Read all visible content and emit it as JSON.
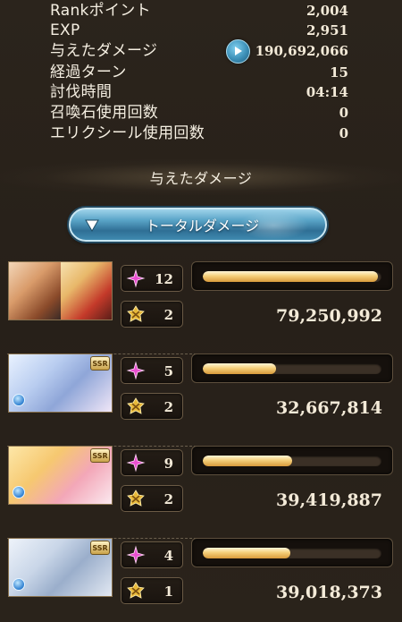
{
  "stats": [
    {
      "label": "Rankポイント",
      "value": "2,004"
    },
    {
      "label": "EXP",
      "value": "2,951"
    },
    {
      "label": "与えたダメージ",
      "value": "190,692,066",
      "has_play_button": true
    },
    {
      "label": "経過ターン",
      "value": "15"
    },
    {
      "label": "討伐時間",
      "value": "04:14"
    },
    {
      "label": "召喚石使用回数",
      "value": "0"
    },
    {
      "label": "エリクシール使用回数",
      "value": "0"
    }
  ],
  "section_header": "与えたダメージ",
  "dropdown": {
    "label": "トータルダメージ"
  },
  "characters": [
    {
      "portrait": "dual-character-portrait",
      "count_a": "12",
      "count_b": "2",
      "bar_fraction": 0.98,
      "damage": "79,250,992"
    },
    {
      "portrait": "ssr-character-portrait",
      "badge": "SSR",
      "count_a": "5",
      "count_b": "2",
      "bar_fraction": 0.41,
      "damage": "32,667,814"
    },
    {
      "portrait": "ssr-character-portrait",
      "badge": "SSR",
      "count_a": "9",
      "count_b": "2",
      "bar_fraction": 0.5,
      "damage": "39,419,887"
    },
    {
      "portrait": "ssr-character-portrait",
      "badge": "SSR",
      "count_a": "4",
      "count_b": "1",
      "bar_fraction": 0.49,
      "damage": "39,018,373"
    }
  ],
  "colors": {
    "background": "#2a231b",
    "text": "#f3ead8",
    "bar_fill": "#f4cf7a",
    "dropdown_blue": "#3f8ab0",
    "star_pink": "#e94fd0",
    "crest_gold": "#e8b93a"
  },
  "icons": {
    "play": "play-icon",
    "dropdown_arrow": "triangle-down-icon",
    "count_a": "pink-star-icon",
    "count_b": "gold-crest-icon"
  }
}
